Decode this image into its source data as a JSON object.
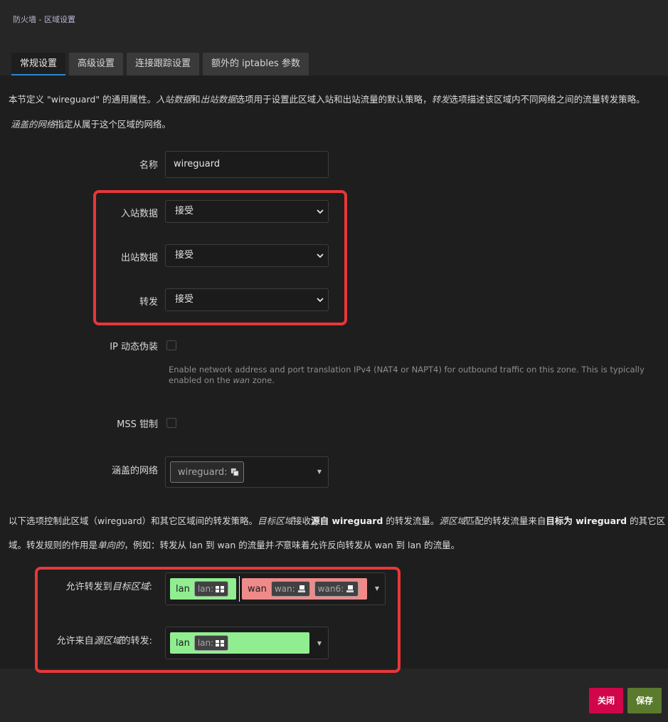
{
  "page": {
    "title": "防火墙 - 区域设置"
  },
  "tabs": [
    {
      "label": "常规设置"
    },
    {
      "label": "高级设置"
    },
    {
      "label": "连接跟踪设置"
    },
    {
      "label": "额外的 iptables 参数"
    }
  ],
  "intro": {
    "line1_a": "本节定义 \"wireguard\" 的通用属性。",
    "line1_b": "入站数据",
    "line1_c": "和",
    "line1_d": "出站数据",
    "line1_e": "选项用于设置此区域入站和出站流量的默认策略，",
    "line1_f": "转发",
    "line1_g": "选项描述该区域内不同网络之间的流量转发策略。",
    "line2_a": "涵盖的网络",
    "line2_b": "指定从属于这个区域的网络。"
  },
  "form": {
    "name_label": "名称",
    "name_value": "wireguard",
    "input_label": "入站数据",
    "input_value": "接受",
    "output_label": "出站数据",
    "output_value": "接受",
    "forward_label": "转发",
    "forward_value": "接受",
    "masq_label": "IP 动态伪装",
    "masq_help_a": "Enable network address and port translation IPv4 (NAT4 or NAPT4) for outbound traffic on this zone. This is typically enabled on the",
    "masq_help_b": "wan",
    "masq_help_c": "zone.",
    "mss_label": "MSS 钳制",
    "networks_label": "涵盖的网络",
    "networks_tag": "wireguard:"
  },
  "forward_info": {
    "l1_a": "以下选项控制此区域（wireguard）和其它区域间的转发策略。",
    "l1_b": "目标区域",
    "l1_c": "接收",
    "l1_d": "源自 wireguard",
    "l1_e": " 的转发流量。",
    "l1_f": "源区域",
    "l1_g": "匹配的转发流量来自",
    "l1_h": "目标为 wireguard",
    "l1_i": " 的其它区",
    "l2_a": "域。转发规则的作用是",
    "l2_b": "单向的",
    "l2_c": "，例如：转发从 lan 到 wan 的流量并",
    "l2_d": "不",
    "l2_e": "意味着允许反向转发从 wan 到 lan 的流量。"
  },
  "forward_dest": {
    "label_a": "允许转发到",
    "label_b": "目标区域",
    "label_c": ":",
    "zones": [
      {
        "name": "lan",
        "tags": [
          "lan:"
        ],
        "color": "#90ee90"
      },
      {
        "name": "wan",
        "tags": [
          "wan:",
          "wan6:"
        ],
        "color": "#f08a8a"
      }
    ]
  },
  "forward_src": {
    "label_a": "允许来自",
    "label_b": "源区域",
    "label_c": "的转发:",
    "zones": [
      {
        "name": "lan",
        "tags": [
          "lan:"
        ],
        "color": "#90ee90"
      }
    ]
  },
  "buttons": {
    "close": "关闭",
    "save": "保存"
  },
  "colors": {
    "highlight": "#e8373a",
    "close_button": "#d1064a",
    "save_button": "#5a7a2e",
    "tab_active_underline": "#2d85d6"
  }
}
